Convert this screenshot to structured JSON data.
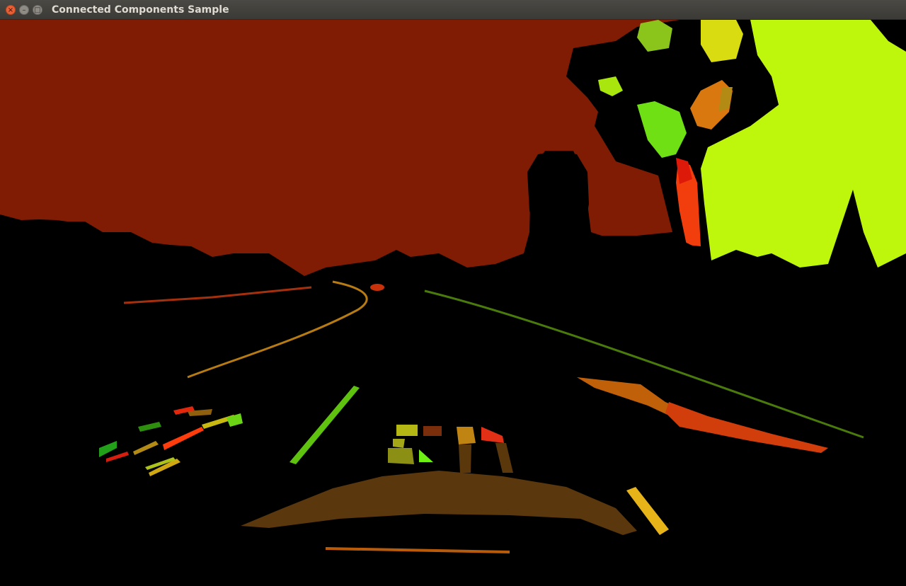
{
  "window": {
    "title": "Connected Components Sample",
    "controls": {
      "close_glyph": "×",
      "minimize_glyph": "–",
      "maximize_glyph": "□"
    }
  },
  "colors": {
    "sky": "#801c04",
    "foliage_yellowgreen": "#bff70c",
    "road_black": "#000000",
    "hood_brown": "#5a370c",
    "lane_green": "#5ec20f",
    "lane_orange": "#c0610a",
    "trunk_red": "#f23d0d",
    "titlebar": "#3c3b37",
    "title_text": "#dfdbd2"
  }
}
